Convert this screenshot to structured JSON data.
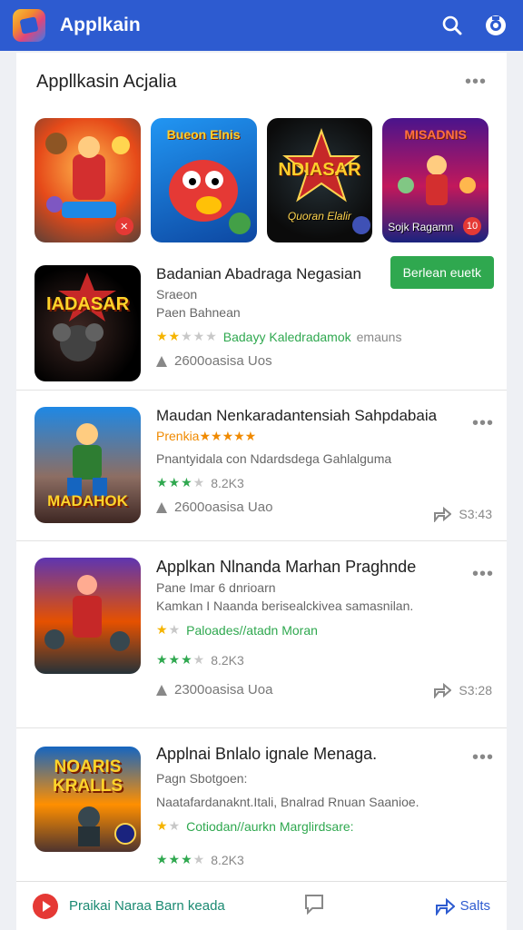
{
  "app": {
    "title": "Applkain"
  },
  "section": {
    "title": "Appllkasin Acjalia",
    "more": "•••"
  },
  "featured": [
    {
      "title": "Bueon Elnis",
      "caption": ""
    },
    {
      "title": "",
      "caption": ""
    },
    {
      "title": "NDIASAR",
      "caption": "Quoran Elalir"
    },
    {
      "title": "MISADNIS",
      "caption": "Sojk Ragamn"
    }
  ],
  "items": [
    {
      "icon_title": "IADASAR",
      "name": "Badanian Abadraga Negasian",
      "sub1": "Sraeon",
      "sub2": "Paen Bahnean",
      "rating_note": "Badayy Kaledradamok",
      "rating_extra": "emauns",
      "downloads": "2600oasisa Uos",
      "install": "Berlean euetk",
      "share": ""
    },
    {
      "icon_title": "MADAHOK",
      "name": "Maudan Nenkaradantensiah Sahpdabaia",
      "sub1": "Prenkia★★★★★",
      "desc": "Pnantyidala con Ndardsdega Gahlalguma",
      "rating_value": "8.2K3",
      "downloads": "2600oasisa Uao",
      "share": "S3:43"
    },
    {
      "icon_title": "",
      "name": "Applkan Nlnanda Marhan Praghnde",
      "sub1": "Pane Imar 6 dnrioarn",
      "desc": "Kamkan I Naanda berisealckivea samasnilan.",
      "rating_note": "Paloades//atadn Moran",
      "rating_value": "8.2K3",
      "downloads": "2300oasisa Uoa",
      "share": "S3:28"
    },
    {
      "icon_title": "NOARIS KRALLS",
      "name": "Applnai Bnlalo ignale Menaga.",
      "sub1": "Pagn Sbotgoen:",
      "desc": "Naatafardanaknt.Itali, Bnalrad Rnuan Saanioe.",
      "rating_note": "Cotiodan//aurkn Marglirdsare:",
      "rating_value": "8.2K3"
    }
  ],
  "bottom": {
    "label": "Praikai Naraa Barn keada",
    "share": "Salts"
  },
  "colors": {
    "appbar": "#2d5bd0",
    "install": "#2fa84f",
    "accent_green": "#2fa84f",
    "star": "#f5b400"
  },
  "icons": [
    "search-icon",
    "camera-icon",
    "more-icon",
    "star-icon",
    "download-icon",
    "share-icon",
    "play-icon",
    "message-icon"
  ]
}
